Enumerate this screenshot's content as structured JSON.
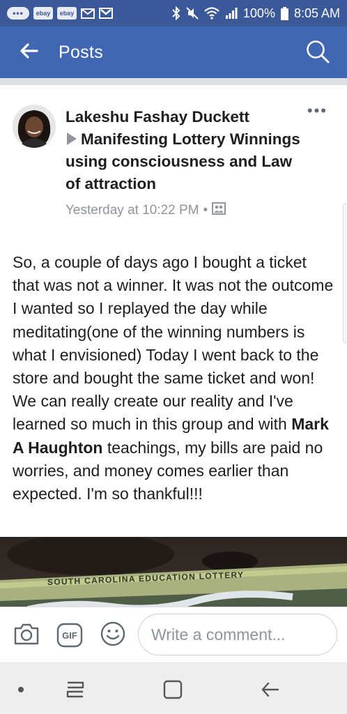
{
  "status_bar": {
    "left_icons": [
      "more-dots-icon",
      "ebay-icon",
      "ebay-icon",
      "mail-icon",
      "gmail-icon"
    ],
    "ebay_label": "ebay",
    "right_icons": [
      "bluetooth-icon",
      "mute-icon",
      "wifi-icon",
      "signal-icon",
      "battery-icon"
    ],
    "battery": "100%",
    "time": "8:05 AM"
  },
  "app_bar": {
    "title": "Posts",
    "back_icon": "back-arrow-icon",
    "search_icon": "search-icon"
  },
  "post": {
    "author": "Lakeshu Fashay Duckett",
    "group": "Manifesting Lottery Winnings using consciousness and Law of attraction",
    "timestamp": "Yesterday at 10:22 PM",
    "separator": "•",
    "privacy_icon": "group-privacy-icon",
    "more_label": "•••",
    "body": {
      "before": "So, a couple of days ago I bought a ticket that was not a winner. It was not the outcome I wanted so I replayed the day while meditating(one of the winning numbers is what I envisioned) Today I went back to the store and bought the same ticket and won! We can really create our reality and I've learned so much in this group and with ",
      "mention": "Mark A Haughton",
      "after": " teachings, my bills are paid no worries, and money comes earlier than expected. I'm so thankful!!!"
    },
    "photo_text": "SOUTH CAROLINA EDUCATION LOTTERY"
  },
  "comment_bar": {
    "camera_icon": "camera-icon",
    "gif_label": "GIF",
    "emoji_icon": "smiley-icon",
    "placeholder": "Write a comment..."
  },
  "nav_bar": {
    "items": [
      "dot-icon",
      "recent-apps-icon",
      "home-icon",
      "back-icon"
    ]
  },
  "colors": {
    "status_bar": "#3b5998",
    "app_bar": "#4267b2",
    "meta_gray": "#90949c",
    "text": "#1c1e21"
  }
}
